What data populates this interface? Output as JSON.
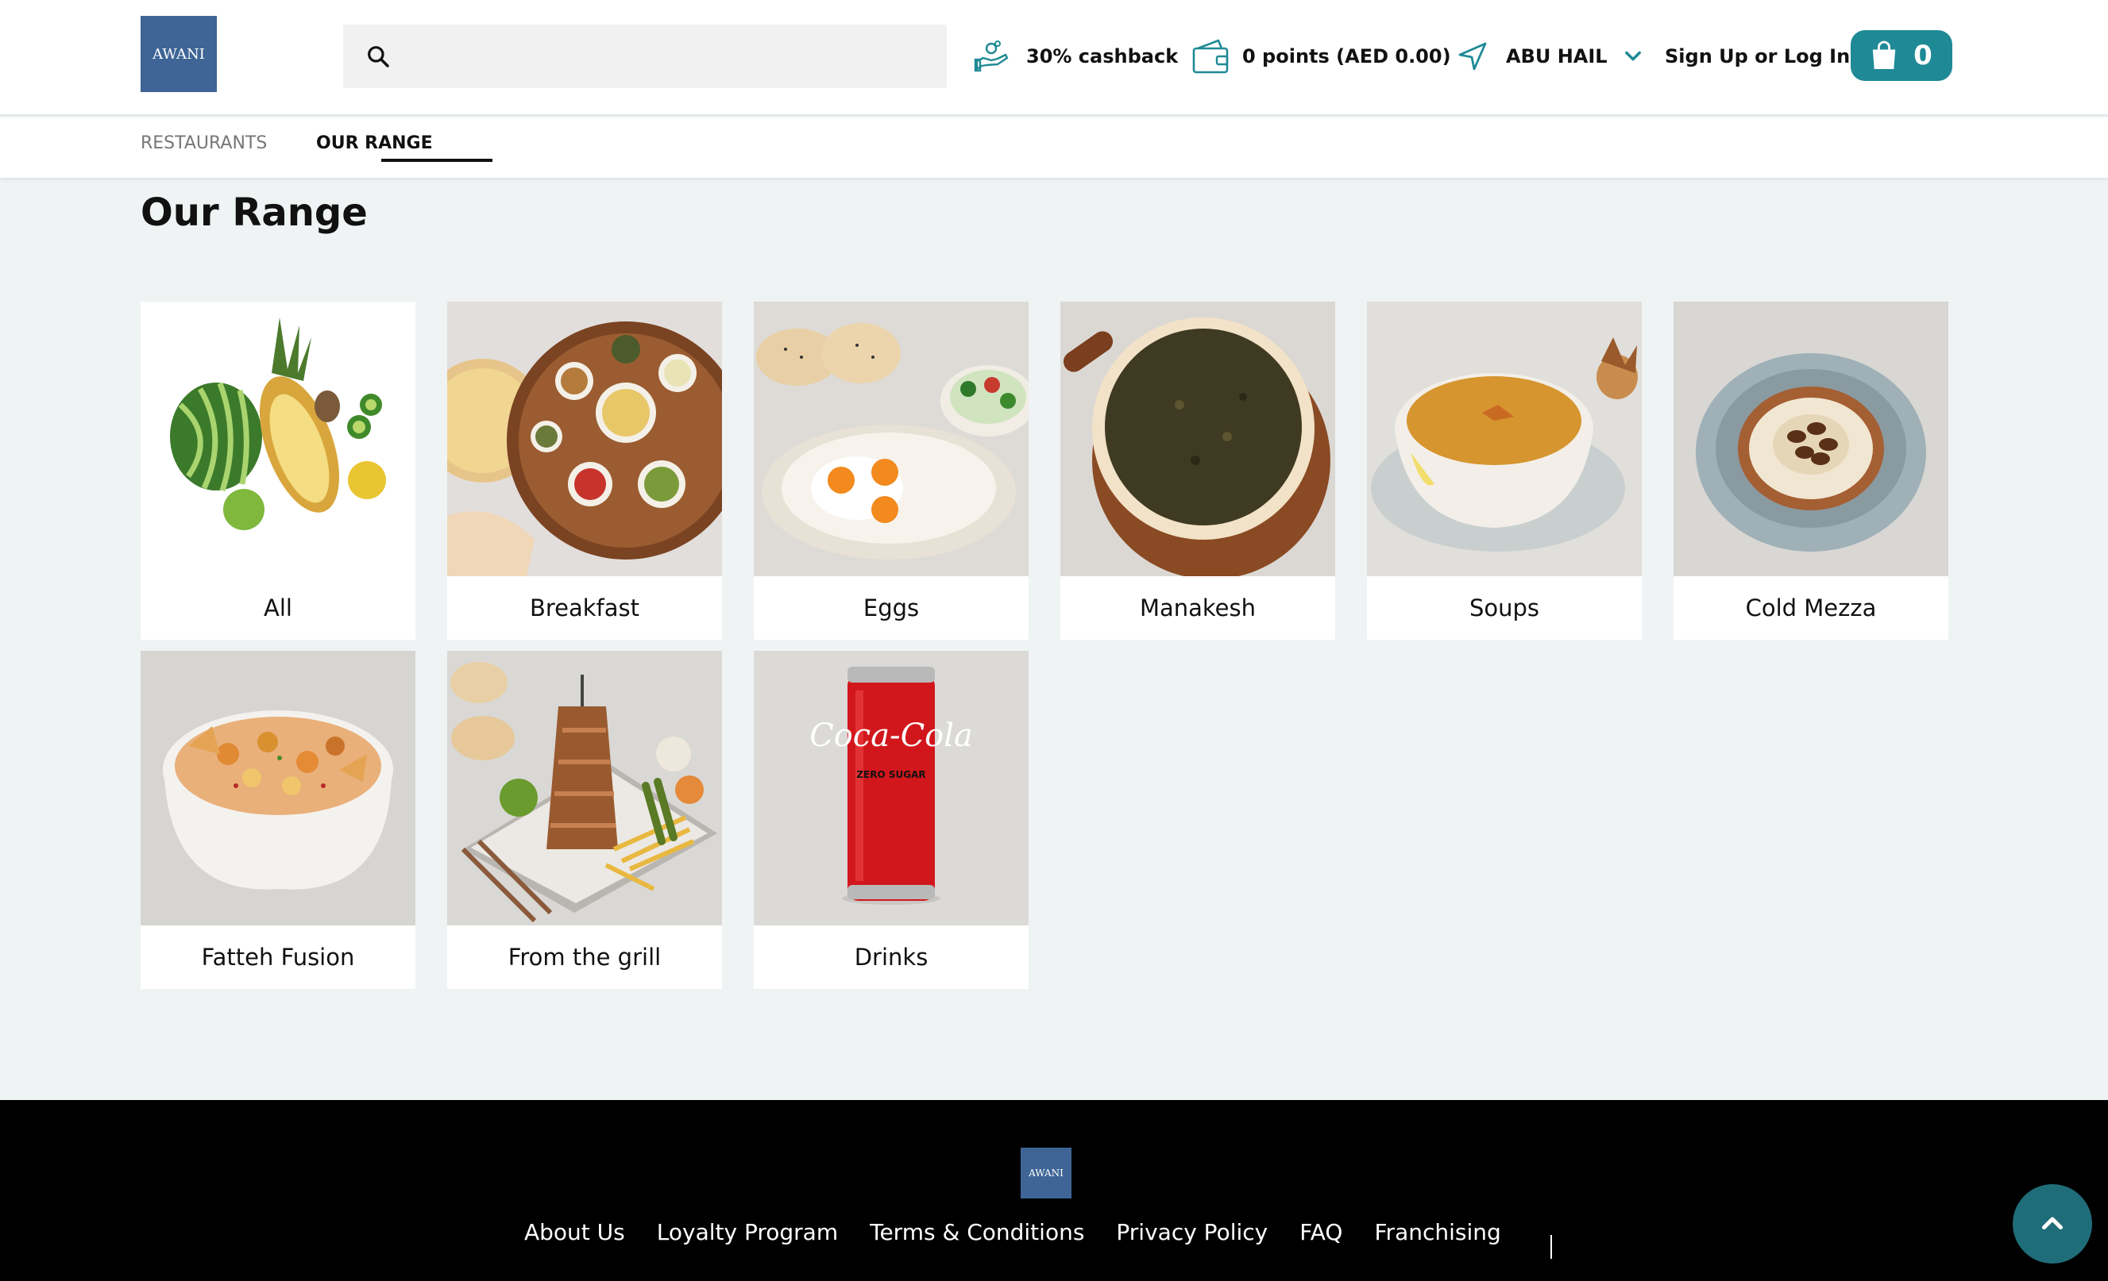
{
  "brand": {
    "logo_text": "AWANI"
  },
  "header": {
    "search": {
      "placeholder": "",
      "value": ""
    },
    "cashback_label": "30% cashback",
    "points_label": "0 points (AED 0.00)",
    "location_label": "ABU HAIL",
    "signup_label": "Sign Up or Log In",
    "cart_count": "0"
  },
  "tabs": [
    {
      "label": "RESTAURANTS",
      "active": false
    },
    {
      "label": "OUR RANGE",
      "active": true
    }
  ],
  "page": {
    "title": "Our Range"
  },
  "categories": [
    {
      "label": "All"
    },
    {
      "label": "Breakfast"
    },
    {
      "label": "Eggs"
    },
    {
      "label": "Manakesh"
    },
    {
      "label": "Soups"
    },
    {
      "label": "Cold Mezza"
    },
    {
      "label": "Fatteh Fusion"
    },
    {
      "label": "From the grill"
    },
    {
      "label": "Drinks"
    }
  ],
  "drink_can_text": {
    "brand": "Coca-Cola",
    "sub": "ZERO SUGAR"
  },
  "footer": {
    "logo_text": "AWANI",
    "links": [
      "About Us",
      "Loyalty Program",
      "Terms & Conditions",
      "Privacy Policy",
      "FAQ",
      "Franchising"
    ]
  },
  "colors": {
    "accent": "#1f8a95",
    "logo_bg": "#3e6596",
    "page_bg": "#eff3f4",
    "footer_bg": "#000000"
  }
}
